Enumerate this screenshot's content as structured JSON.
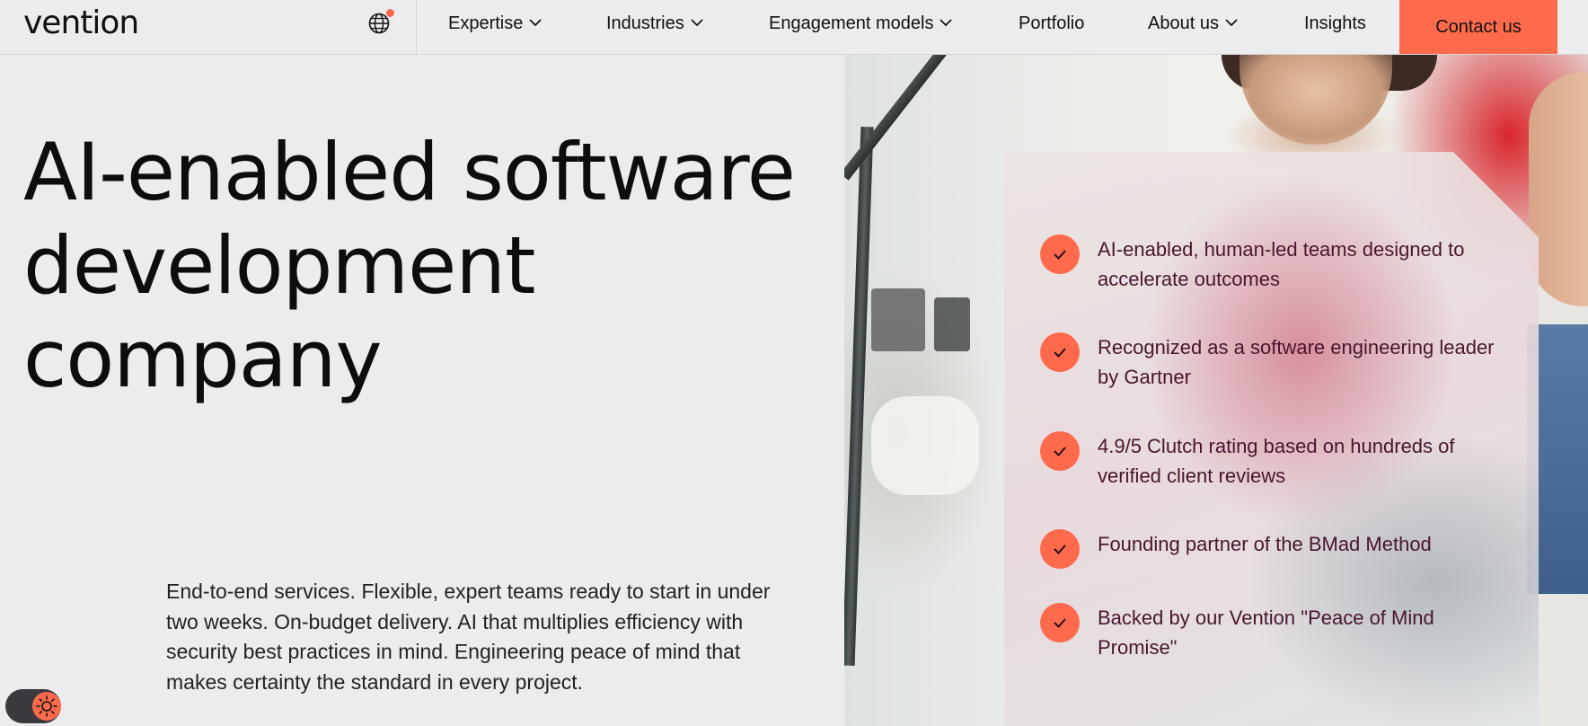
{
  "brand": {
    "logo_text": "vention"
  },
  "nav": {
    "items": [
      {
        "label": "Expertise",
        "has_dropdown": true
      },
      {
        "label": "Industries",
        "has_dropdown": true
      },
      {
        "label": "Engagement models",
        "has_dropdown": true
      },
      {
        "label": "Portfolio",
        "has_dropdown": false
      },
      {
        "label": "About us",
        "has_dropdown": true
      },
      {
        "label": "Insights",
        "has_dropdown": false
      }
    ],
    "contact_label": "Contact us"
  },
  "hero": {
    "title_lines": [
      "AI-enabled software",
      "development",
      "company"
    ],
    "description": "End-to-end services. Flexible, expert teams ready to start in under two weeks. On-budget delivery. AI that multiplies efficiency with security best practices in mind. Engineering peace of mind that makes certainty the standard in every project."
  },
  "features": [
    "AI-enabled, human-led teams designed to accelerate outcomes",
    "Recognized as a software engineering leader by Gartner",
    "4.9/5 Clutch rating based on hundreds of verified client reviews",
    "Founding partner of the BMad Method",
    "Backed by our Vention \"Peace of Mind Promise\""
  ],
  "colors": {
    "accent": "#ff6a4d",
    "feature_text": "#4a1530",
    "background": "#ececee"
  },
  "icons": {
    "language": "globe-icon",
    "dropdown": "chevron-down-icon",
    "feature": "check-icon",
    "theme": "sun-icon"
  }
}
